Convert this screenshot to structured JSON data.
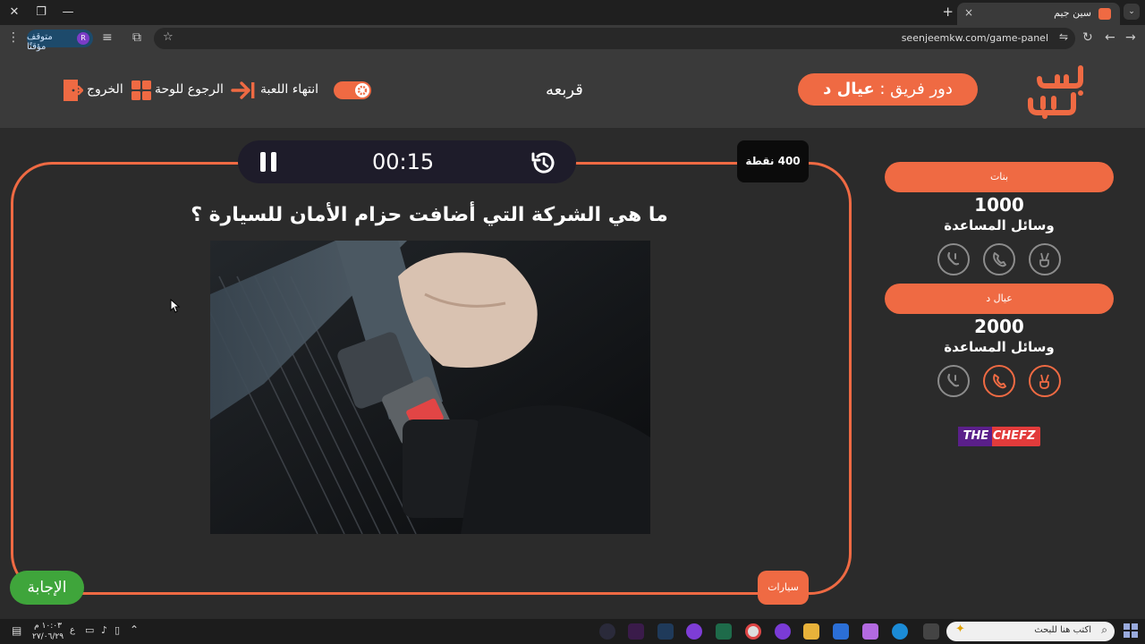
{
  "browser": {
    "tab_title": "سين جيم",
    "tab_close": "×",
    "new_tab": "+",
    "url": "seenjeemkw.com/game-panel",
    "profile_label": "متوقف مؤقتًا",
    "profile_initial": "R",
    "window_minimize": "—",
    "window_restore": "❐",
    "window_close": "✕"
  },
  "header": {
    "turn_prefix": "دور فريق : ",
    "turn_team": "عيال د",
    "game_title": "قربعه",
    "end_game": "انتهاء اللعبة",
    "back_to_board": "الرجوع للوحة",
    "exit": "الخروج"
  },
  "board": {
    "timer": "00:15",
    "points": "400 نقطة",
    "question": "ما هي الشركة التي أضافت حزام الأمان للسيارة ؟",
    "category": "سيارات",
    "answer_button": "الإجابة"
  },
  "teams": [
    {
      "name": "بنات",
      "score": "1000",
      "help_label": "وسائل المساعدة"
    },
    {
      "name": "عيال د",
      "score": "2000",
      "help_label": "وسائل المساعدة"
    }
  ],
  "sponsor": {
    "text": "THE CHEFZ"
  },
  "taskbar": {
    "search_placeholder": "اكتب هنا للبحث",
    "time": "١٠:٠٣ م",
    "date": "٢٧/٠٦/٢٩",
    "lang": "ع"
  },
  "colors": {
    "accent": "#ef6a43",
    "answer": "#3fa53b",
    "background": "#2b2b2b",
    "header": "#3a3a3a"
  }
}
